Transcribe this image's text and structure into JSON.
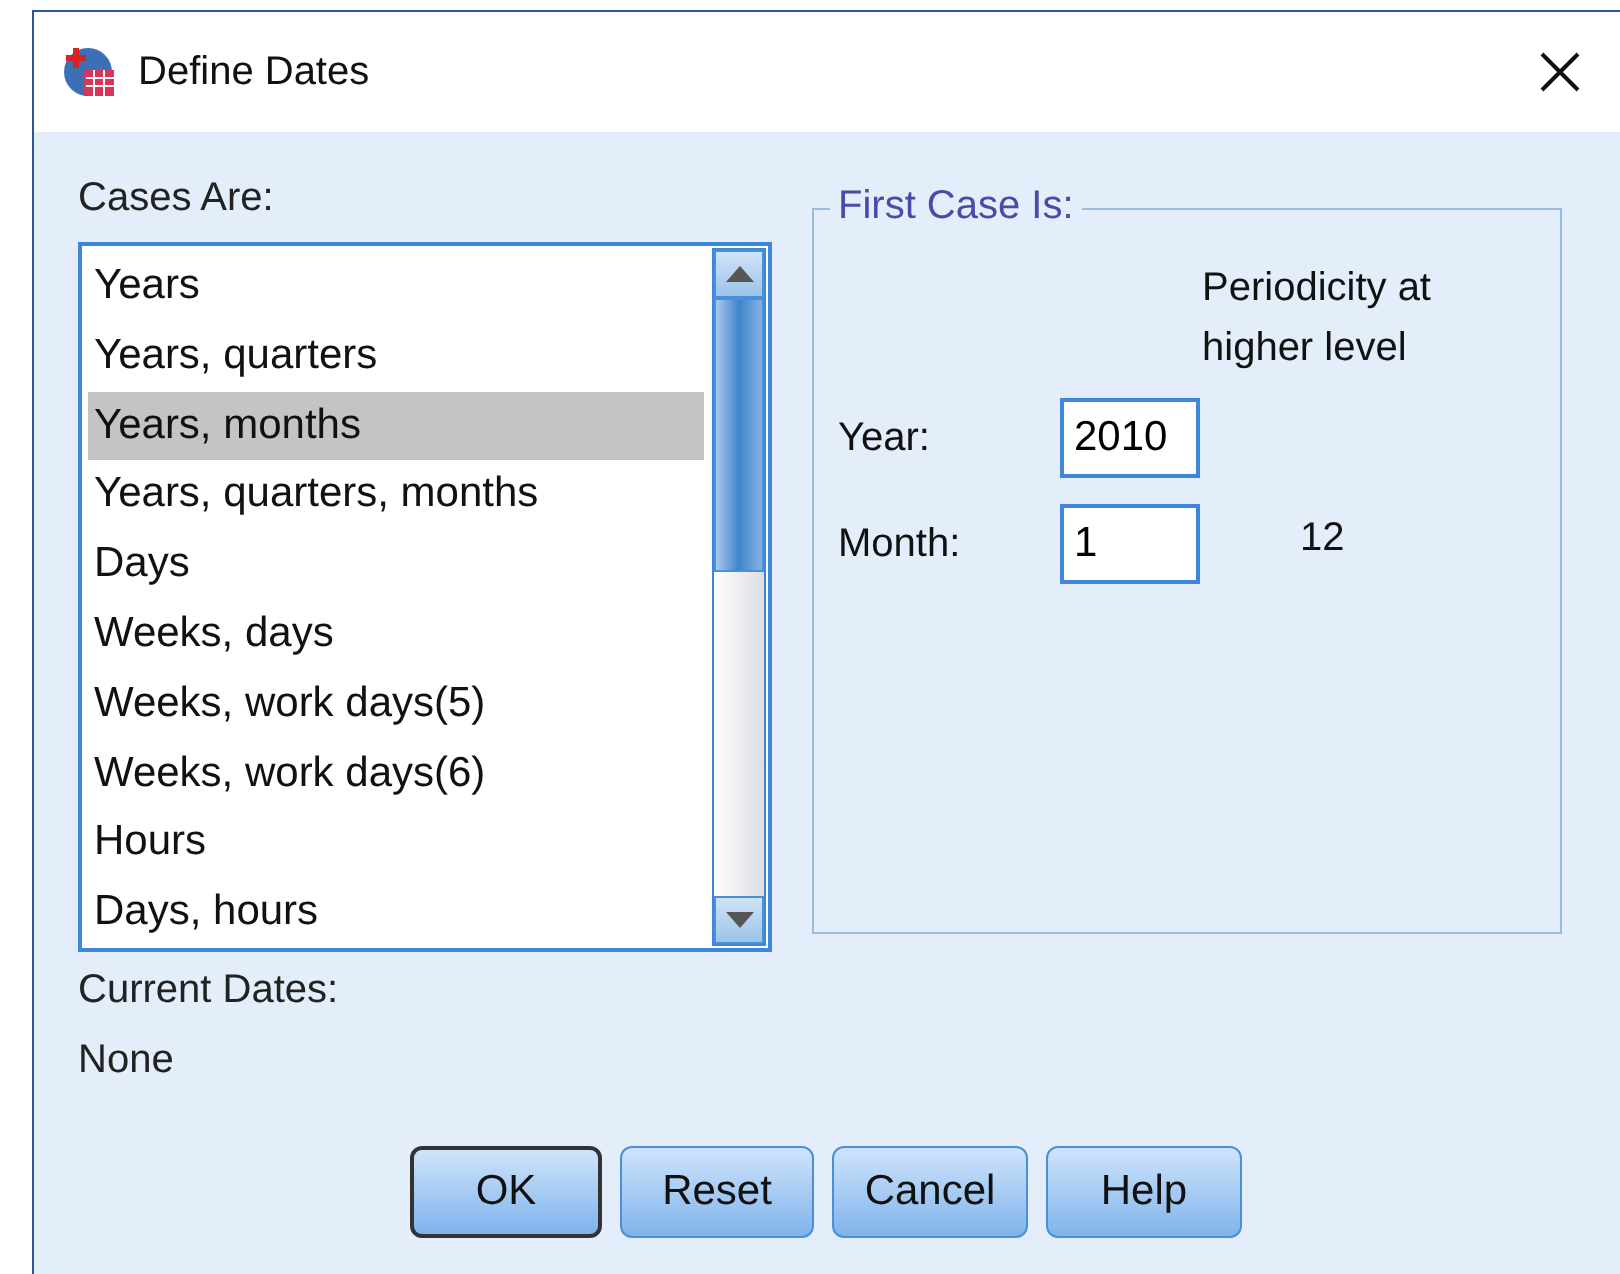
{
  "window": {
    "title": "Define Dates"
  },
  "cases": {
    "label": "Cases Are:",
    "items": [
      {
        "label": "Years",
        "selected": false
      },
      {
        "label": "Years, quarters",
        "selected": false
      },
      {
        "label": "Years, months",
        "selected": true
      },
      {
        "label": "Years, quarters, months",
        "selected": false
      },
      {
        "label": "Days",
        "selected": false
      },
      {
        "label": "Weeks, days",
        "selected": false
      },
      {
        "label": "Weeks, work days(5)",
        "selected": false
      },
      {
        "label": "Weeks, work days(6)",
        "selected": false
      },
      {
        "label": "Hours",
        "selected": false
      },
      {
        "label": "Days, hours",
        "selected": false
      }
    ]
  },
  "first_case": {
    "title": "First Case Is:",
    "periodicity_header": "Periodicity at higher level",
    "fields": [
      {
        "label": "Year:",
        "value": "2010"
      },
      {
        "label": "Month:",
        "value": "1",
        "periodicity": "12"
      }
    ]
  },
  "current_dates": {
    "label": "Current Dates:",
    "value": "None"
  },
  "buttons": [
    {
      "label": "OK",
      "default": true
    },
    {
      "label": "Reset",
      "default": false
    },
    {
      "label": "Cancel",
      "default": false
    },
    {
      "label": "Help",
      "default": false
    }
  ]
}
